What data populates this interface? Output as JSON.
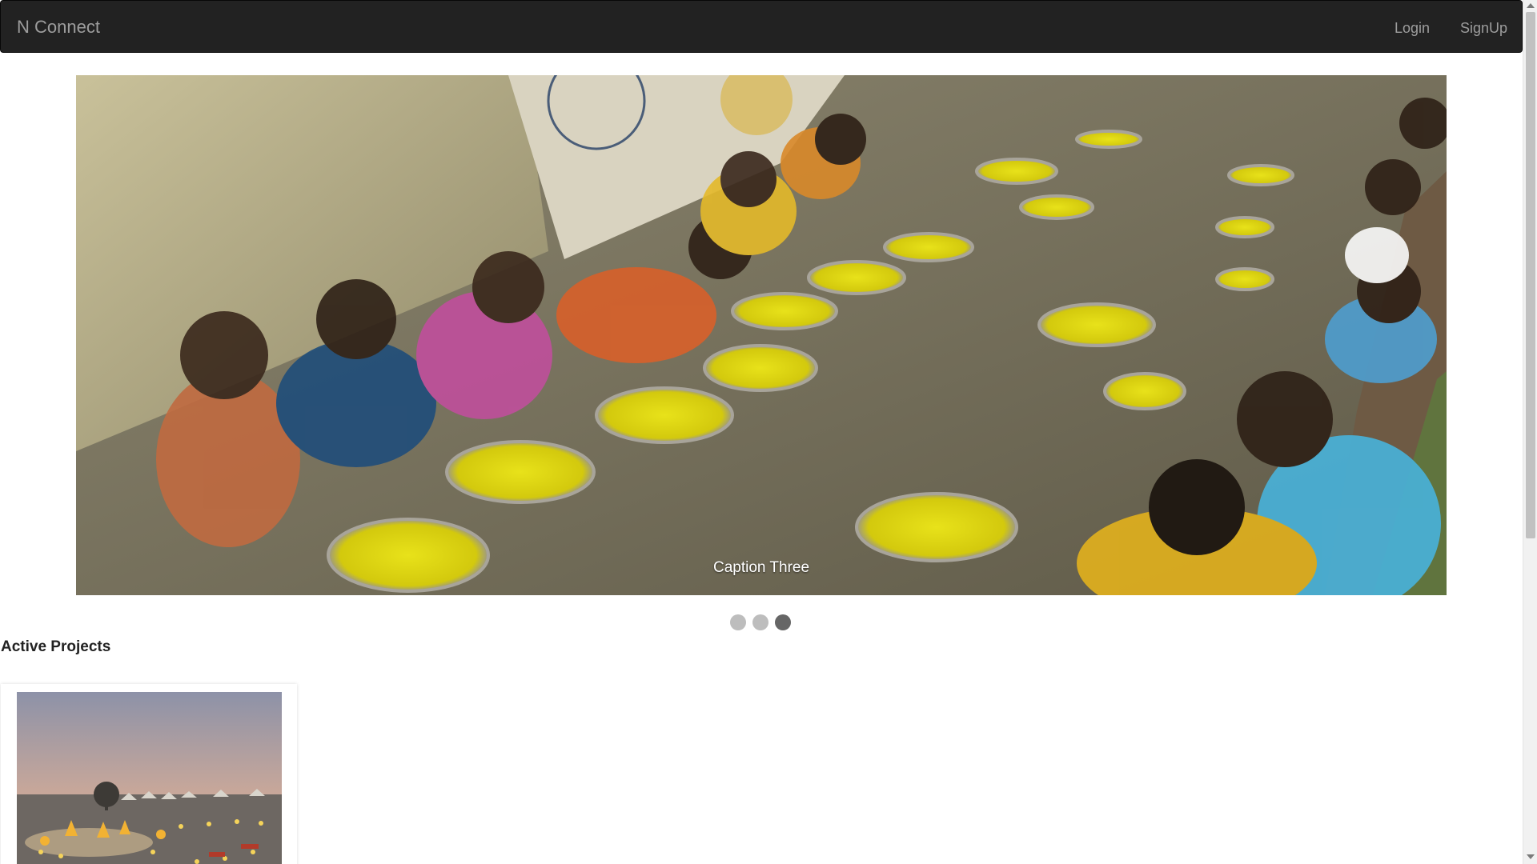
{
  "navbar": {
    "brand": "N Connect",
    "links": [
      {
        "label": "Login"
      },
      {
        "label": "SignUp"
      }
    ],
    "background": "#222222",
    "text_color": "#9d9d9d"
  },
  "carousel": {
    "caption": "Caption Three",
    "slide_count": 3,
    "active_index": 2,
    "image": "children-eating-meal-photo"
  },
  "active_projects": {
    "heading": "Active Projects",
    "cards": [
      {
        "image": "desert-camp-evening-photo"
      }
    ]
  }
}
